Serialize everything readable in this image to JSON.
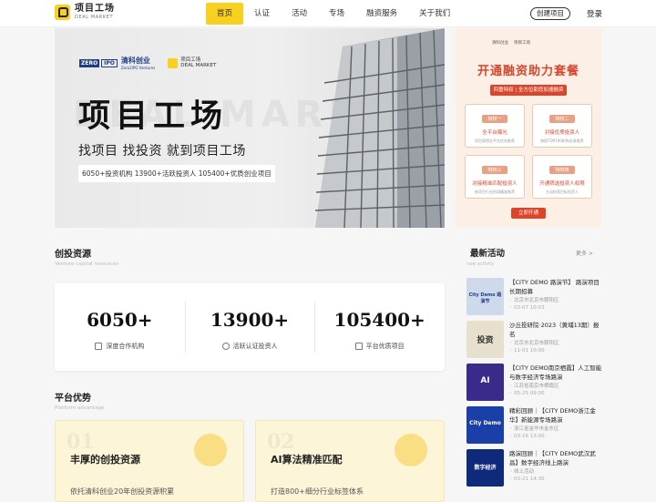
{
  "header": {
    "logo_cn": "项目工场",
    "logo_en": "DEAL MARKET",
    "nav": [
      {
        "label": "首页",
        "active": true
      },
      {
        "label": "认证"
      },
      {
        "label": "活动"
      },
      {
        "label": "专场"
      },
      {
        "label": "融资服务"
      },
      {
        "label": "关于我们"
      }
    ],
    "create_project": "创建项目",
    "login": "登录"
  },
  "banner": {
    "zero_a": "ZERO",
    "zero_b": "IPO",
    "partner_cn": "清科创业",
    "partner_en": "Zero2IPO Ventures",
    "logo_cn": "项目工场",
    "logo_en": "DEAL MARKET",
    "watermark": "DEAL MARKET",
    "title": "项目工场",
    "subtitle": "找项目 找投资 就到项目工场",
    "stats": "6050+投资机构  13900+活跃投资人  105400+优质创业项目"
  },
  "promo": {
    "logo_a": "清科创业",
    "logo_b": "项目工场",
    "title": "开通融资助力套餐",
    "tag": "四重特权 | 全方位助您加速融资",
    "cards": [
      {
        "head": "特权一",
        "title": "全平台曝光",
        "desc": "项目获得全平台优先推荐"
      },
      {
        "head": "特权二",
        "title": "对接优质投资人",
        "desc": "按照TOP100机构名录推荐"
      },
      {
        "head": "特权三",
        "title": "对接精准匹配投资人",
        "desc": "依项目行业阶段精准推荐"
      },
      {
        "head": "特权四",
        "title": "开通筛选投资人权限",
        "desc": "主动检索目标投资人"
      }
    ],
    "button": "立即开通"
  },
  "sections": {
    "resources_title": "创投资源",
    "resources_sub": "Venture capital resources",
    "advantage_title": "平台优势",
    "advantage_sub": "Platform advantage"
  },
  "stats": [
    {
      "num": "6050+",
      "label": "深度合作机构"
    },
    {
      "num": "13900+",
      "label": "活跃认证投资人"
    },
    {
      "num": "105400+",
      "label": "平台优质项目"
    }
  ],
  "advantages": [
    {
      "num": "01",
      "title": "丰厚的创投资源",
      "desc": "依托清科创业20年创投资源积累"
    },
    {
      "num": "02",
      "title": "AI算法精准匹配",
      "desc": "打造800+细分行业标签体系"
    }
  ],
  "news": {
    "title": "最新活动",
    "more": "更多 >",
    "sub": "new activity",
    "items": [
      {
        "title": "【CITY DEMO 路演节】 路演项目长期招募",
        "loc": "北京市北京市朝阳区",
        "time": "03-07 10:03",
        "thumb_text": "City Demo 路演节",
        "color": "#cfd9ec"
      },
      {
        "title": "沙丘投研院·2023（黄埔13期）报名",
        "loc": "北京市北京市朝阳区",
        "time": "11-01 10:00",
        "thumb_text": "投资",
        "color": "#e8e0cf"
      },
      {
        "title": "【CITY DEMO南京栖霞】人工智能与数字经济专场路演",
        "loc": "江苏省南京市栖霞区",
        "time": "05-25 09:00",
        "thumb_text": "AI",
        "color": "#3a2a8a"
      },
      {
        "title": "精彩回顾｜【CITY DEMO浙江金华】新能源专场路演",
        "loc": "浙江省金华市金东区",
        "time": "03-16 13:00",
        "thumb_text": "City Demo",
        "color": "#1a3fa8"
      },
      {
        "title": "路演回顾｜【CITY DEMO武汉武昌】数字经济线上路演",
        "loc": "线上活动",
        "time": "03-21 14:30",
        "thumb_text": "数字经济",
        "color": "#0f2a7a"
      }
    ]
  }
}
